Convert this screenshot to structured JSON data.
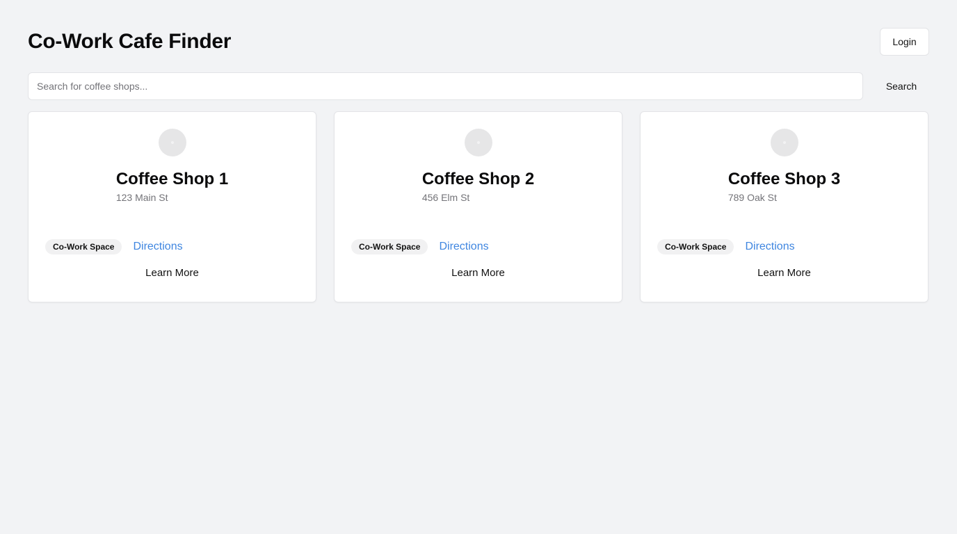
{
  "header": {
    "title": "Co-Work Cafe Finder",
    "login_label": "Login"
  },
  "search": {
    "placeholder": "Search for coffee shops...",
    "value": "",
    "button_label": "Search"
  },
  "shops": [
    {
      "name": "Coffee Shop 1",
      "address": "123 Main St",
      "badge": "Co-Work Space",
      "directions_label": "Directions",
      "learn_more_label": "Learn More"
    },
    {
      "name": "Coffee Shop 2",
      "address": "456 Elm St",
      "badge": "Co-Work Space",
      "directions_label": "Directions",
      "learn_more_label": "Learn More"
    },
    {
      "name": "Coffee Shop 3",
      "address": "789 Oak St",
      "badge": "Co-Work Space",
      "directions_label": "Directions",
      "learn_more_label": "Learn More"
    }
  ],
  "colors": {
    "background": "#f2f3f5",
    "link": "#3f86e0",
    "badge_bg": "#f1f1f2",
    "avatar_placeholder": "#e6e6e7"
  },
  "icons": {
    "card_avatar": "image-placeholder-icon"
  }
}
